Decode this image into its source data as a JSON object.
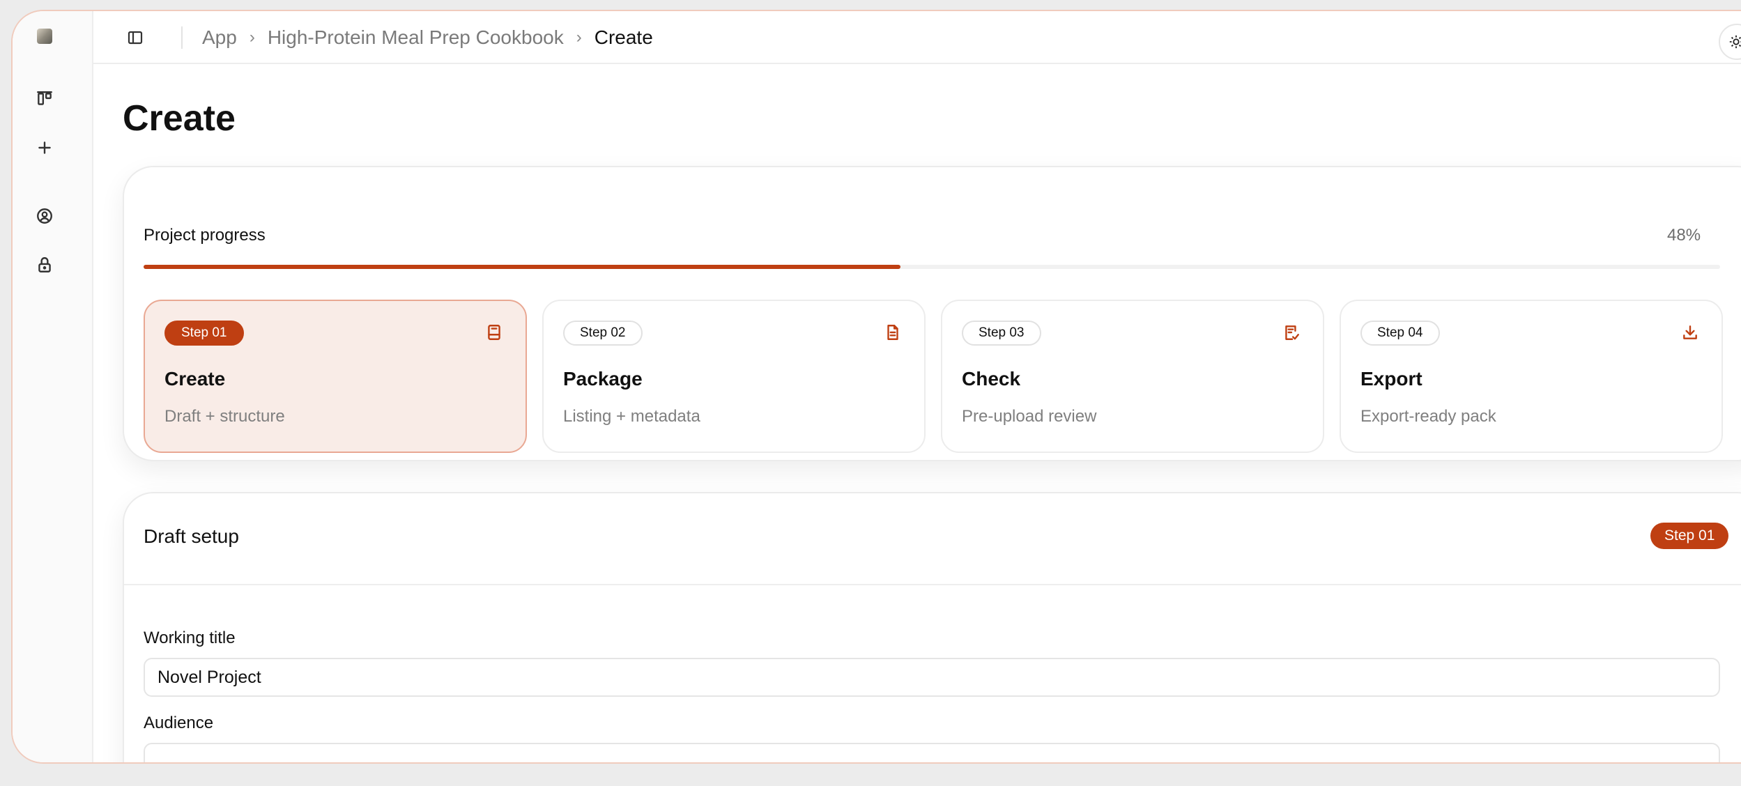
{
  "sidebar": {
    "icons": [
      "app-logo-icon",
      "board-icon",
      "plus-icon",
      "account-icon",
      "lock-icon"
    ]
  },
  "topbar": {
    "breadcrumb": [
      "App",
      "High-Protein Meal Prep Cookbook",
      "Create"
    ],
    "separator": "›"
  },
  "page": {
    "title": "Create"
  },
  "progress": {
    "label": "Project progress",
    "percent_text": "48%",
    "value": 48,
    "accent_color": "#bf3f12"
  },
  "steps": [
    {
      "badge": "Step 01",
      "title": "Create",
      "subtitle": "Draft + structure",
      "icon": "book-icon",
      "active": true
    },
    {
      "badge": "Step 02",
      "title": "Package",
      "subtitle": "Listing + metadata",
      "icon": "document-icon",
      "active": false
    },
    {
      "badge": "Step 03",
      "title": "Check",
      "subtitle": "Pre-upload review",
      "icon": "checklist-icon",
      "active": false
    },
    {
      "badge": "Step 04",
      "title": "Export",
      "subtitle": "Export-ready pack",
      "icon": "download-icon",
      "active": false
    }
  ],
  "draft": {
    "title": "Draft setup",
    "badge": "Step 01",
    "fields": [
      {
        "label": "Working title",
        "value": "Novel Project",
        "placeholder": ""
      },
      {
        "label": "Audience",
        "value": "",
        "placeholder": ""
      }
    ]
  }
}
